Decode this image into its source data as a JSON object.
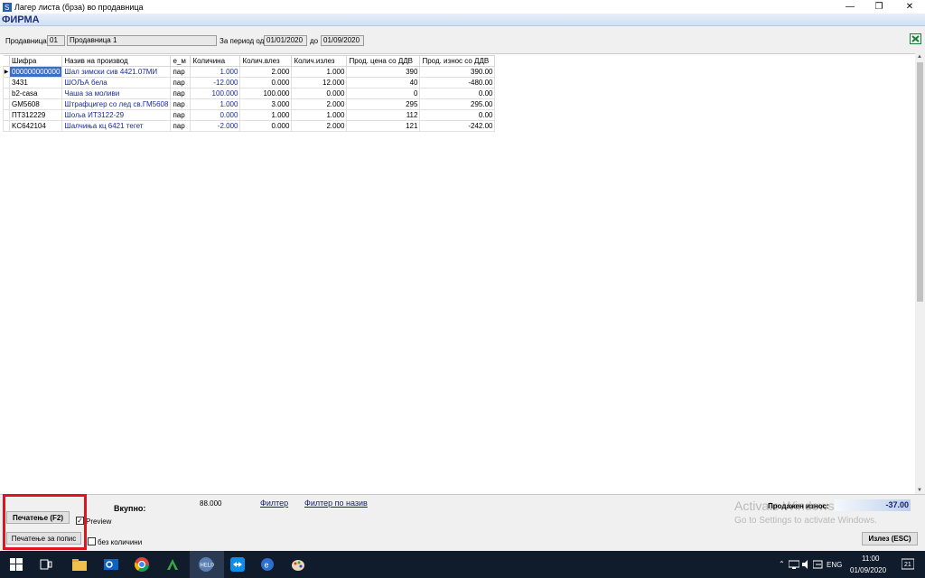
{
  "window": {
    "title": "Лагер листа (брза) во продавница"
  },
  "header": {
    "firm": "ФИРМА"
  },
  "filters": {
    "store_label": "Продавница",
    "store_code": "01",
    "store_name": "Продавница 1",
    "period_label": "За период од",
    "date_from": "01/01/2020",
    "to_label": "до",
    "date_to": "01/09/2020"
  },
  "table": {
    "columns": [
      "Шифра",
      "Назив на производ",
      "е_м",
      "Количина",
      "Колич.влез",
      "Колич.излез",
      "Прод. цена со ДДВ",
      "Прод. износ со ДДВ"
    ],
    "rows": [
      [
        "000000000000",
        "Шал зимски сив 4421.07МИ",
        "пар",
        "1.000",
        "2.000",
        "1.000",
        "390",
        "390.00"
      ],
      [
        "3431",
        "ШОЉА бела",
        "пар",
        "-12.000",
        "0.000",
        "12.000",
        "40",
        "-480.00"
      ],
      [
        "b2-casa",
        "Чаша за моливи",
        "пар",
        "100.000",
        "100.000",
        "0.000",
        "0",
        "0.00"
      ],
      [
        "GM5608",
        "Штрафцигер со лед св.ГМ5608",
        "пар",
        "1.000",
        "3.000",
        "2.000",
        "295",
        "295.00"
      ],
      [
        "ПТ312229",
        "Шоља ИТ3122-29",
        "пар",
        "0.000",
        "1.000",
        "1.000",
        "112",
        "0.00"
      ],
      [
        "KC642104",
        "Шалчиња кц 6421 тегет",
        "пар",
        "-2.000",
        "0.000",
        "2.000",
        "121",
        "-242.00"
      ]
    ]
  },
  "footer": {
    "print_button": "Печатење (F2)",
    "print_list_button": "Печатење  за попис",
    "preview_label": "Preview",
    "no_qty_label": "без количини",
    "total_label": "Вкупно:",
    "total_qty": "88.000",
    "filter_link": "Филтер",
    "filter_name_link": "Филтер по назив",
    "activate_title": "Activate Windows",
    "activate_sub": "Go to Settings to activate Windows.",
    "sold_label": "Продажен износ:",
    "sold_value": "-37.00",
    "exit_button": "Излез (ESC)"
  },
  "taskbar": {
    "lang": "ENG",
    "time": "11:00",
    "date": "01/09/2020",
    "notif": "21"
  }
}
